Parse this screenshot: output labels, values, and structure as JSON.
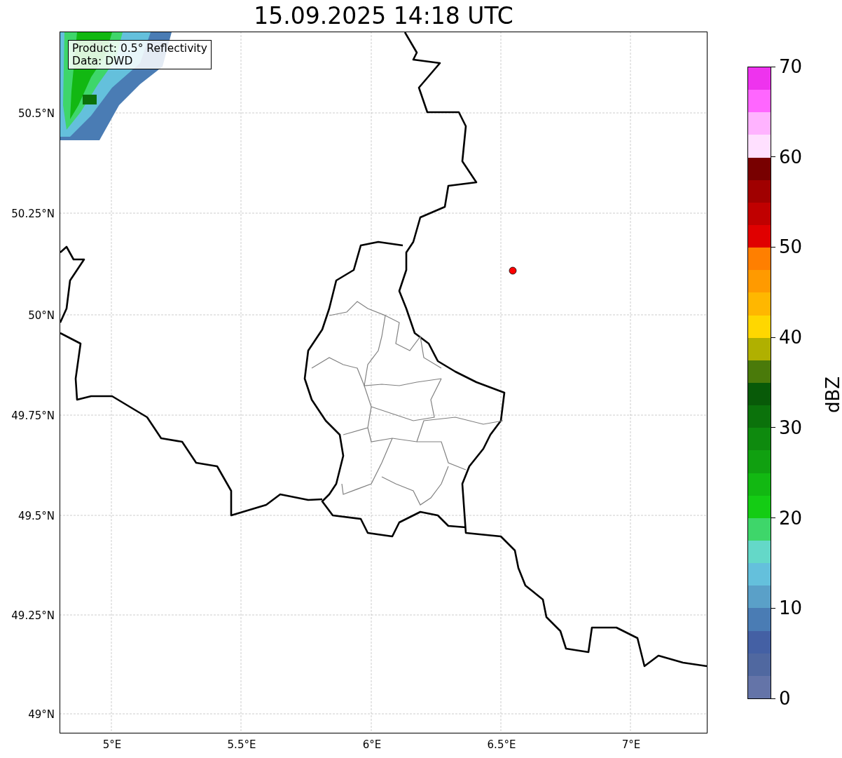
{
  "title": "15.09.2025 14:18 UTC",
  "legend": [
    "Product: 0.5° Reflectivity",
    "Data: DWD"
  ],
  "map": {
    "x_ticks": [
      "5°E",
      "5.5°E",
      "6°E",
      "6.5°E",
      "7°E"
    ],
    "y_ticks": [
      "50.5°N",
      "50.25°N",
      "50°N",
      "49.75°N",
      "49.5°N",
      "49.25°N",
      "49°N"
    ]
  },
  "colorbar": {
    "label": "dBZ",
    "ticks": [
      "70",
      "60",
      "50",
      "40",
      "30",
      "20",
      "10",
      "0"
    ],
    "segments": [
      {
        "color": "#ee33ee"
      },
      {
        "color": "#ff66ff"
      },
      {
        "color": "#ffb3ff"
      },
      {
        "color": "#ffe0ff"
      },
      {
        "color": "#780000"
      },
      {
        "color": "#a00000"
      },
      {
        "color": "#c00000"
      },
      {
        "color": "#e00000"
      },
      {
        "color": "#ff7f00"
      },
      {
        "color": "#ff9a00"
      },
      {
        "color": "#ffb700"
      },
      {
        "color": "#ffd700"
      },
      {
        "color": "#b0b000"
      },
      {
        "color": "#4a7a0a"
      },
      {
        "color": "#085a08"
      },
      {
        "color": "#0b720b"
      },
      {
        "color": "#0e8a0e"
      },
      {
        "color": "#10a010"
      },
      {
        "color": "#12b812"
      },
      {
        "color": "#14cc14"
      },
      {
        "color": "#3ed66a"
      },
      {
        "color": "#64d8c8"
      },
      {
        "color": "#64c0dc"
      },
      {
        "color": "#5aa0c8"
      },
      {
        "color": "#4a7cb4"
      },
      {
        "color": "#4460a4"
      },
      {
        "color": "#5068a0"
      },
      {
        "color": "#6474a8"
      }
    ]
  }
}
